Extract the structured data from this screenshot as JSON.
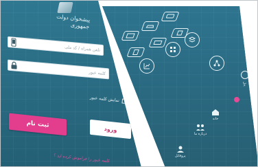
{
  "login": {
    "brand_title": "پیشخوان دولت\nجمهوری",
    "username_placeholder": "تلفن همراه / کد ملی",
    "password_placeholder": "کلمه عبور",
    "remember_label": "نمایش کلمه عبور",
    "register_button": "ثبت نام",
    "login_button": "ورود",
    "forgot_link": "کلمه عبور را فراموش کرده اید ؟"
  },
  "dashboard": {
    "tiles": [
      {
        "label": ""
      },
      {
        "label": ""
      },
      {
        "label": ""
      },
      {
        "label": ""
      },
      {
        "label": ""
      },
      {
        "label": ""
      }
    ],
    "circles": [
      {
        "label": ""
      },
      {
        "label": ""
      },
      {
        "label": ""
      },
      {
        "label": ""
      }
    ],
    "bottom_nav": [
      {
        "label": "خانه"
      },
      {
        "label": "درباره ما"
      },
      {
        "label": "پروفایل"
      }
    ],
    "side_labels": [
      "پنل"
    ]
  },
  "colors": {
    "panel_bg": "#2b6f86",
    "accent_pink": "#e33d8e",
    "button_white": "#ffffff"
  }
}
